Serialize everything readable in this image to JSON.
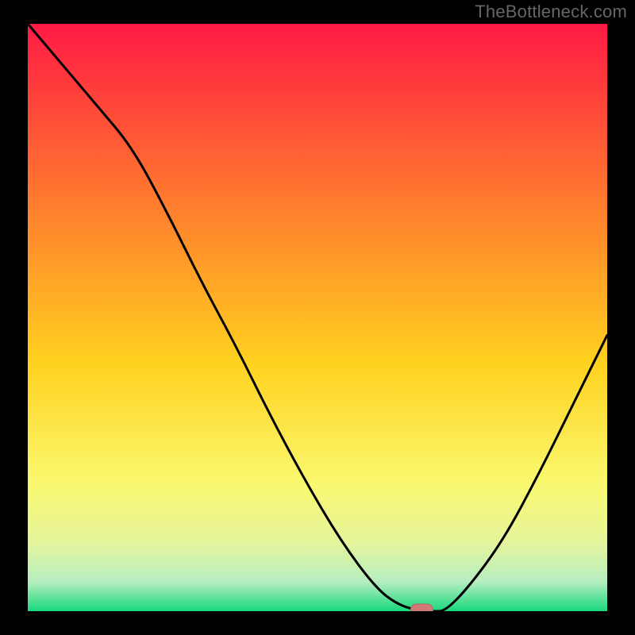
{
  "watermark": "TheBottleneck.com",
  "colors": {
    "frame": "#000000",
    "grad_top": "#ff1a44",
    "grad_upper_mid": "#ff7a2e",
    "grad_mid": "#ffd21f",
    "grad_low1": "#faf86e",
    "grad_low2": "#e6f59a",
    "grad_low3": "#b6eec0",
    "grad_bottom": "#18d87c",
    "curve": "#000000",
    "marker_fill": "#cf7a76",
    "marker_stroke": "#b86460"
  },
  "chart_data": {
    "type": "line",
    "title": "",
    "xlabel": "",
    "ylabel": "",
    "xlim": [
      0,
      100
    ],
    "ylim": [
      0,
      100
    ],
    "x": [
      0,
      6,
      12,
      18,
      24,
      30,
      36,
      42,
      48,
      54,
      60,
      64,
      68,
      70,
      72,
      76,
      82,
      88,
      94,
      100
    ],
    "y": [
      100,
      93,
      86,
      79,
      68,
      56,
      45,
      33,
      22,
      12,
      4,
      1,
      0,
      0,
      0,
      4,
      12,
      23,
      35,
      47
    ],
    "note": "y is mismatch percentage (100=worst/red, 0=best/green). Curve drops from top-left, reaches zero around x≈64–70, then rises toward right edge ending near y≈47.",
    "marker": {
      "x": 68,
      "y": 0,
      "label": "optimal point"
    }
  }
}
